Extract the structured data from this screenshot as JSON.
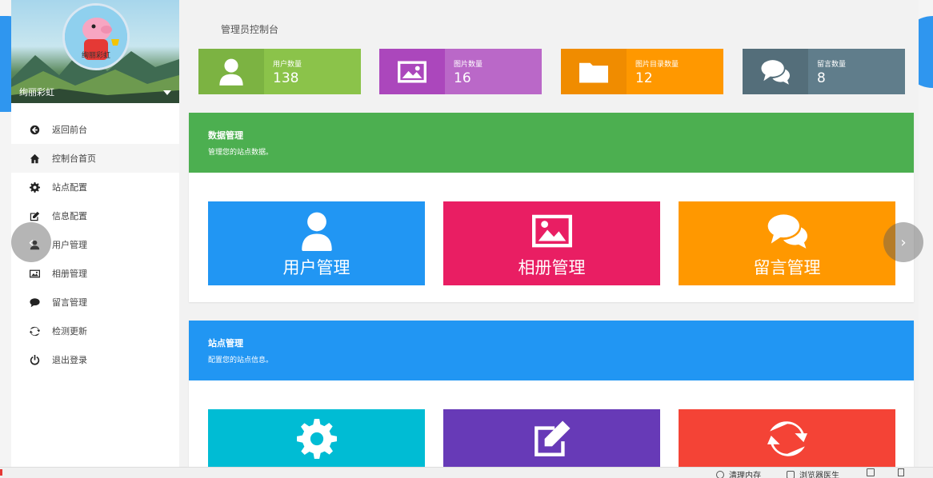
{
  "profile": {
    "avatar_caption": "绚丽彩虹",
    "name": "绚丽彩虹"
  },
  "nav": {
    "items": [
      {
        "label": "返回前台",
        "icon": "arrow-left-circle-icon"
      },
      {
        "label": "控制台首页",
        "icon": "home-icon"
      },
      {
        "label": "站点配置",
        "icon": "gear-icon"
      },
      {
        "label": "信息配置",
        "icon": "edit-icon"
      },
      {
        "label": "用户管理",
        "icon": "user-icon"
      },
      {
        "label": "相册管理",
        "icon": "image-icon"
      },
      {
        "label": "留言管理",
        "icon": "comment-icon"
      },
      {
        "label": "检测更新",
        "icon": "refresh-icon"
      },
      {
        "label": "退出登录",
        "icon": "power-icon"
      }
    ]
  },
  "main": {
    "title": "管理员控制台",
    "stats": [
      {
        "label": "用户数量",
        "value": "138",
        "icon": "user-icon",
        "color": "#8bc34a",
        "dark": "#7cb342"
      },
      {
        "label": "图片数量",
        "value": "16",
        "icon": "image-icon",
        "color": "#ba68c8",
        "dark": "#ab47bc"
      },
      {
        "label": "图片目录数量",
        "value": "12",
        "icon": "folder-icon",
        "color": "#ff9800",
        "dark": "#f08c00"
      },
      {
        "label": "留言数量",
        "value": "8",
        "icon": "comments-icon",
        "color": "#607d8b",
        "dark": "#546e7a"
      }
    ],
    "data_panel": {
      "title": "数据管理",
      "subtitle": "管理您的站点数据。",
      "color": "#4caf50",
      "tiles": [
        {
          "label": "用户管理",
          "icon": "user-icon",
          "color": "#2196f3"
        },
        {
          "label": "相册管理",
          "icon": "image-icon",
          "color": "#e91e63"
        },
        {
          "label": "留言管理",
          "icon": "comments-icon",
          "color": "#ff9800"
        }
      ]
    },
    "site_panel": {
      "title": "站点管理",
      "subtitle": "配置您的站点信息。",
      "color": "#2196f3",
      "tiles": [
        {
          "icon": "gear-icon",
          "color": "#00bcd4"
        },
        {
          "icon": "edit-icon",
          "color": "#673ab7"
        },
        {
          "icon": "refresh-icon",
          "color": "#f44336"
        }
      ]
    }
  },
  "statusbar": {
    "item1": "清理内存",
    "item2": "浏览器医生"
  }
}
